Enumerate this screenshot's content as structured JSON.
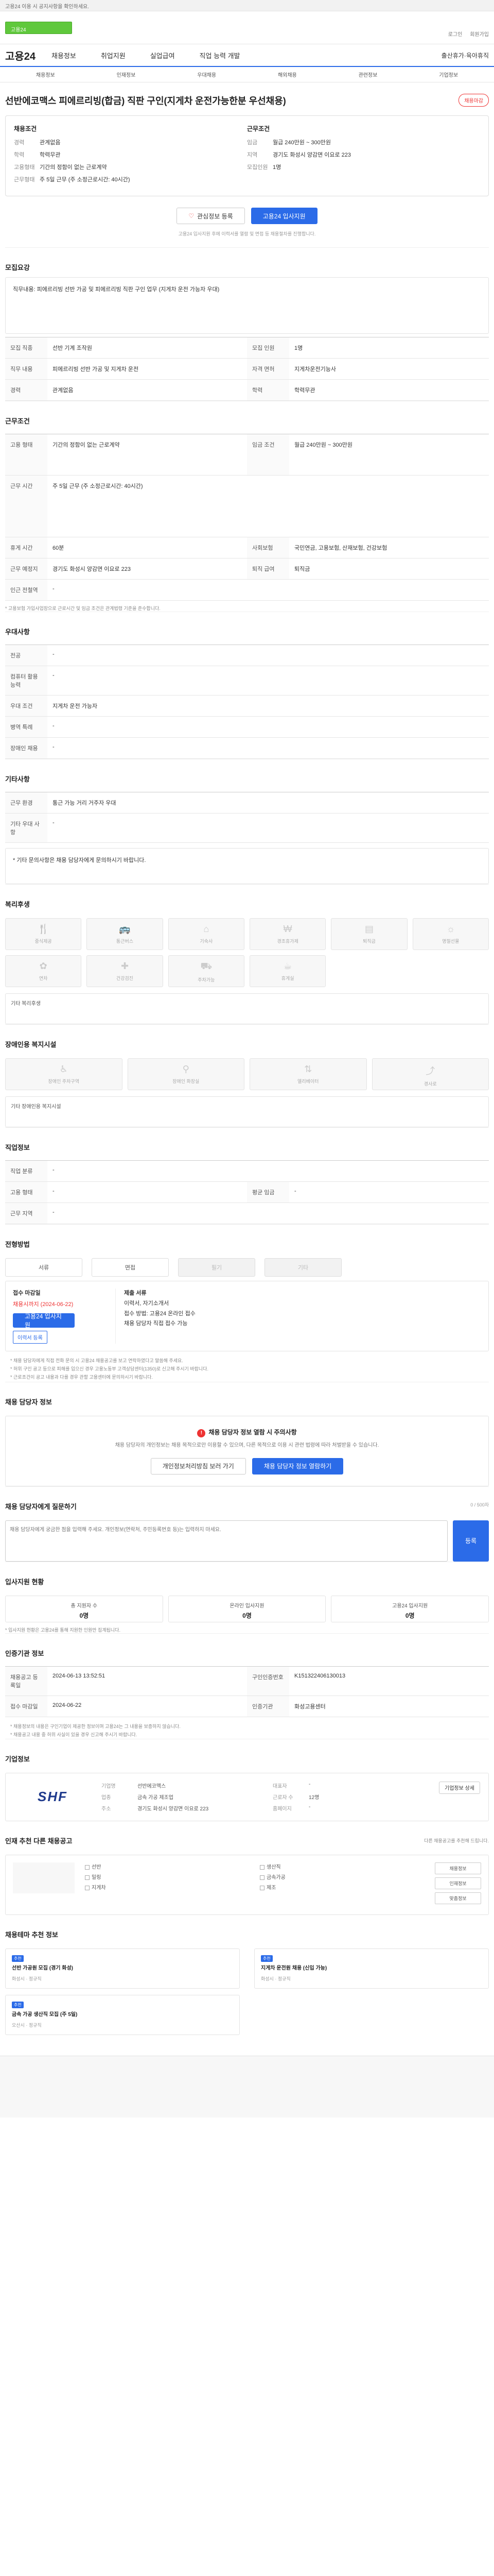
{
  "topbar": {
    "text": "고용24 이용 시 공지사항을 확인하세요."
  },
  "header": {
    "util": [
      "로그인",
      "회원가입"
    ],
    "brand": "고용24",
    "menu": [
      "채용정보",
      "취업지원",
      "실업급여",
      "직업 능력 개발"
    ],
    "right": "출산휴가·육아휴직"
  },
  "subnav": [
    "채용정보",
    "인재정보",
    "우대채용",
    "해외채용",
    "관련정보",
    "기업정보"
  ],
  "job": {
    "title": "선반에코맥스 피에르리빙(합금) 직판 구인(지게차 운전가능한분 우선채용)",
    "badge": "채용마감",
    "left_head": "채용조건",
    "right_head": "근무조건",
    "left": [
      {
        "k": "경력",
        "v": "관계없음"
      },
      {
        "k": "학력",
        "v": "학력무관"
      },
      {
        "k": "고용형태",
        "v": "기간의 정함이 없는 근로계약"
      },
      {
        "k": "근무형태",
        "v": "주 5일 근무 (주 소정근로시간: 40시간)"
      }
    ],
    "right": [
      {
        "k": "임금",
        "v": "월급 240만원 ~ 300만원"
      },
      {
        "k": "지역",
        "v": "경기도 화성시 양감면 이요로 223"
      },
      {
        "k": "모집인원",
        "v": "1명"
      }
    ],
    "btn_scrap": "관심정보 등록",
    "btn_apply": "고용24 입사지원",
    "note": "고용24 입사지원 후에 이력서를 열람 및 면접 등 채용절차를 진행합니다."
  },
  "sections": {
    "recruit": "모집요강",
    "work": "근무조건",
    "pref": "우대사항",
    "other": "기타사항",
    "welfare": "복리후생",
    "disabled": "장애인용 복지시설",
    "job_support": "직업정보",
    "process": "전형방법",
    "contact": "채용 담당자 정보",
    "qa": "채용 담당자에게 질문하기",
    "stats": "입사지원 현황",
    "manager": "인증기관 정보",
    "company": "기업정보",
    "related": "인재 추천 다른 채용공고",
    "interests": "채용테마 추천 정보"
  },
  "recruit_box": "직무내용: 피에르리빙 선반 가공 및 피에르리빙 직판 구인 업무 (지게차 운전 가능자 우대)",
  "recruit_rows": [
    {
      "k": "모집 직종",
      "v": "선반 기계 조작원"
    },
    {
      "k": "모집 인원",
      "v": "1명"
    },
    {
      "k": "직무 내용",
      "v": "피에르리빙 선반 가공 및 지게차 운전"
    },
    {
      "k": "자격 면허",
      "v": "지게차운전기능사"
    },
    {
      "k": "경력",
      "v": "관계없음"
    },
    {
      "k": "학력",
      "v": "학력무관"
    }
  ],
  "work_rows": [
    {
      "k": "고용 형태",
      "v": "기간의 정함이 없는 근로계약"
    },
    {
      "k": "임금 조건",
      "v": "월급 240만원 ~ 300만원"
    },
    {
      "k": "근무 시간",
      "v": "주 5일 근무 (주 소정근로시간: 40시간)"
    },
    {
      "k": "휴게 시간",
      "v": "60분"
    },
    {
      "k": "사회보험",
      "v": "국민연금, 고용보험, 산재보험, 건강보험"
    },
    {
      "k": "근무 예정지",
      "v": "경기도 화성시 양감면 이요로 223"
    },
    {
      "k": "퇴직 급여",
      "v": "퇴직금"
    },
    {
      "k": "인근 전철역",
      "v": "-"
    }
  ],
  "work_note": "* 고용보험 가입사업장으로 근로시간 및 임금 조건은 관계법령 기준을 준수합니다.",
  "pref_rows": [
    {
      "k": "전공",
      "v": "-"
    },
    {
      "k": "컴퓨터 활용 능력",
      "v": "-"
    },
    {
      "k": "우대 조건",
      "v": "지게차 운전 가능자"
    },
    {
      "k": "병역 특례",
      "v": "-"
    },
    {
      "k": "장애인 채용",
      "v": "-"
    }
  ],
  "other_rows": [
    {
      "k": "근무 환경",
      "v": "통근 가능 거리 거주자 우대"
    },
    {
      "k": "기타 우대 사항",
      "v": "-"
    }
  ],
  "other_box": "* 기타 문의사항은 채용 담당자에게 문의하시기 바랍니다.",
  "welfare_items": [
    {
      "icon": "meal-icon",
      "label": "중식제공"
    },
    {
      "icon": "bus-icon",
      "label": "통근버스"
    },
    {
      "icon": "dorm-icon",
      "label": "기숙사"
    },
    {
      "icon": "money-icon",
      "label": "경조휴가제"
    },
    {
      "icon": "doc-icon",
      "label": "퇴직금"
    },
    {
      "icon": "holiday-icon",
      "label": "명절선물"
    },
    {
      "icon": "gift-icon",
      "label": "연차"
    },
    {
      "icon": "health-icon",
      "label": "건강검진"
    },
    {
      "icon": "car-icon",
      "label": "주차가능"
    },
    {
      "icon": "cafe-icon",
      "label": "휴게실"
    }
  ],
  "welfare_hist": "기타 복리후생",
  "disabled_items": [
    {
      "icon": "ramp-icon",
      "label": "장애인 주차구역"
    },
    {
      "icon": "toilet-icon",
      "label": "장애인 화장실"
    },
    {
      "icon": "elevator-icon",
      "label": "엘리베이터"
    },
    {
      "icon": "exit-icon",
      "label": "경사로"
    }
  ],
  "disabled_hist": "기타 장애인용 복지시설",
  "job_rows": [
    {
      "k": "직업 분류",
      "v": "-"
    },
    {
      "k": "고용 형태",
      "v": "-"
    },
    {
      "k": "평균 임금",
      "v": "-"
    },
    {
      "k": "근무 지역",
      "v": "-"
    }
  ],
  "process": [
    "서류",
    "면접",
    "필기",
    "기타"
  ],
  "apply": {
    "head": "접수 마감일",
    "deadline": "채용시까지 (2024-06-22)",
    "btn_apply": "고용24 입사지원",
    "btn_reg": "이력서 등록",
    "head2": "제출 서류",
    "docs": "이력서, 자기소개서",
    "method": "접수 방법: 고용24 온라인 접수",
    "contact": "채용 담당자 직접 접수 가능"
  },
  "apply_notes": [
    "* 채용 담당자에게 직접 전화 문의 시 고용24 채용공고를 보고 연락하였다고 말씀해 주세요.",
    "* 허위 구인 공고 등으로 피해를 입으신 경우 고용노동부 고객상담센터(1350)로 신고해 주시기 바랍니다.",
    "* 근로조건이 공고 내용과 다를 경우 관할 고용센터에 문의하시기 바랍니다."
  ],
  "contact_alert": {
    "title": "채용 담당자 정보 열람 시 주의사항",
    "text": "채용 담당자의 개인정보는 채용 목적으로만 이용할 수 있으며, 다른 목적으로 이용 시 관련 법령에 따라 처벌받을 수 있습니다.",
    "btn1": "개인정보처리방침 보러 가기",
    "btn2": "채용 담당자 정보 열람하기"
  },
  "qa": {
    "placeholder": "채용 담당자에게 궁금한 점을 입력해 주세요. 개인정보(연락처, 주민등록번호 등)는 입력하지 마세요.",
    "send": "등록",
    "count": "0 / 500자"
  },
  "stats": [
    {
      "label": "총 지원자 수",
      "value": "0명"
    },
    {
      "label": "온라인 입사지원",
      "value": "0명"
    },
    {
      "label": "고용24 입사지원",
      "value": "0명"
    }
  ],
  "stats_note": "* 입사지원 현황은 고용24를 통해 지원한 인원만 집계됩니다.",
  "manager_rows": [
    {
      "k": "채용공고 등록일",
      "v": "2024-06-13 13:52:51",
      "k2": "구인인증번호",
      "v2": "K151322406130013"
    },
    {
      "k": "접수 마감일",
      "v": "2024-06-22",
      "k2": "인증기관",
      "v2": "화성고용센터"
    }
  ],
  "manager_notes": [
    "* 채용정보의 내용은 구인기업이 제공한 정보이며 고용24는 그 내용을 보증하지 않습니다.",
    "* 채용공고 내용 중 허위 사실이 있을 경우 신고해 주시기 바랍니다."
  ],
  "company": {
    "logo": "SHF",
    "rows": [
      {
        "k": "기업명",
        "v": "선반에코맥스"
      },
      {
        "k": "대표자",
        "v": "-"
      },
      {
        "k": "업종",
        "v": "금속 가공 제조업"
      },
      {
        "k": "근로자 수",
        "v": "12명"
      },
      {
        "k": "주소",
        "v": "경기도 화성시 양감면 이요로 223"
      },
      {
        "k": "홈페이지",
        "v": "-"
      }
    ],
    "btn": "기업정보 상세"
  },
  "related": {
    "note": "다른 채용공고를 추천해 드립니다.",
    "checks": [
      "선반",
      "밀링",
      "지게차",
      "생산직",
      "금속가공",
      "제조"
    ],
    "side": [
      "채용정보",
      "인재정보",
      "맞춤정보"
    ]
  },
  "interest_cards": [
    {
      "tag": "추천",
      "title": "선반 가공원 모집 (경기 화성)",
      "meta": "화성시 · 정규직"
    },
    {
      "tag": "추천",
      "title": "지게차 운전원 채용 (신입 가능)",
      "meta": "화성시 · 정규직"
    },
    {
      "tag": "추천",
      "title": "금속 가공 생산직 모집 (주 5일)",
      "meta": "오산시 · 정규직"
    }
  ]
}
